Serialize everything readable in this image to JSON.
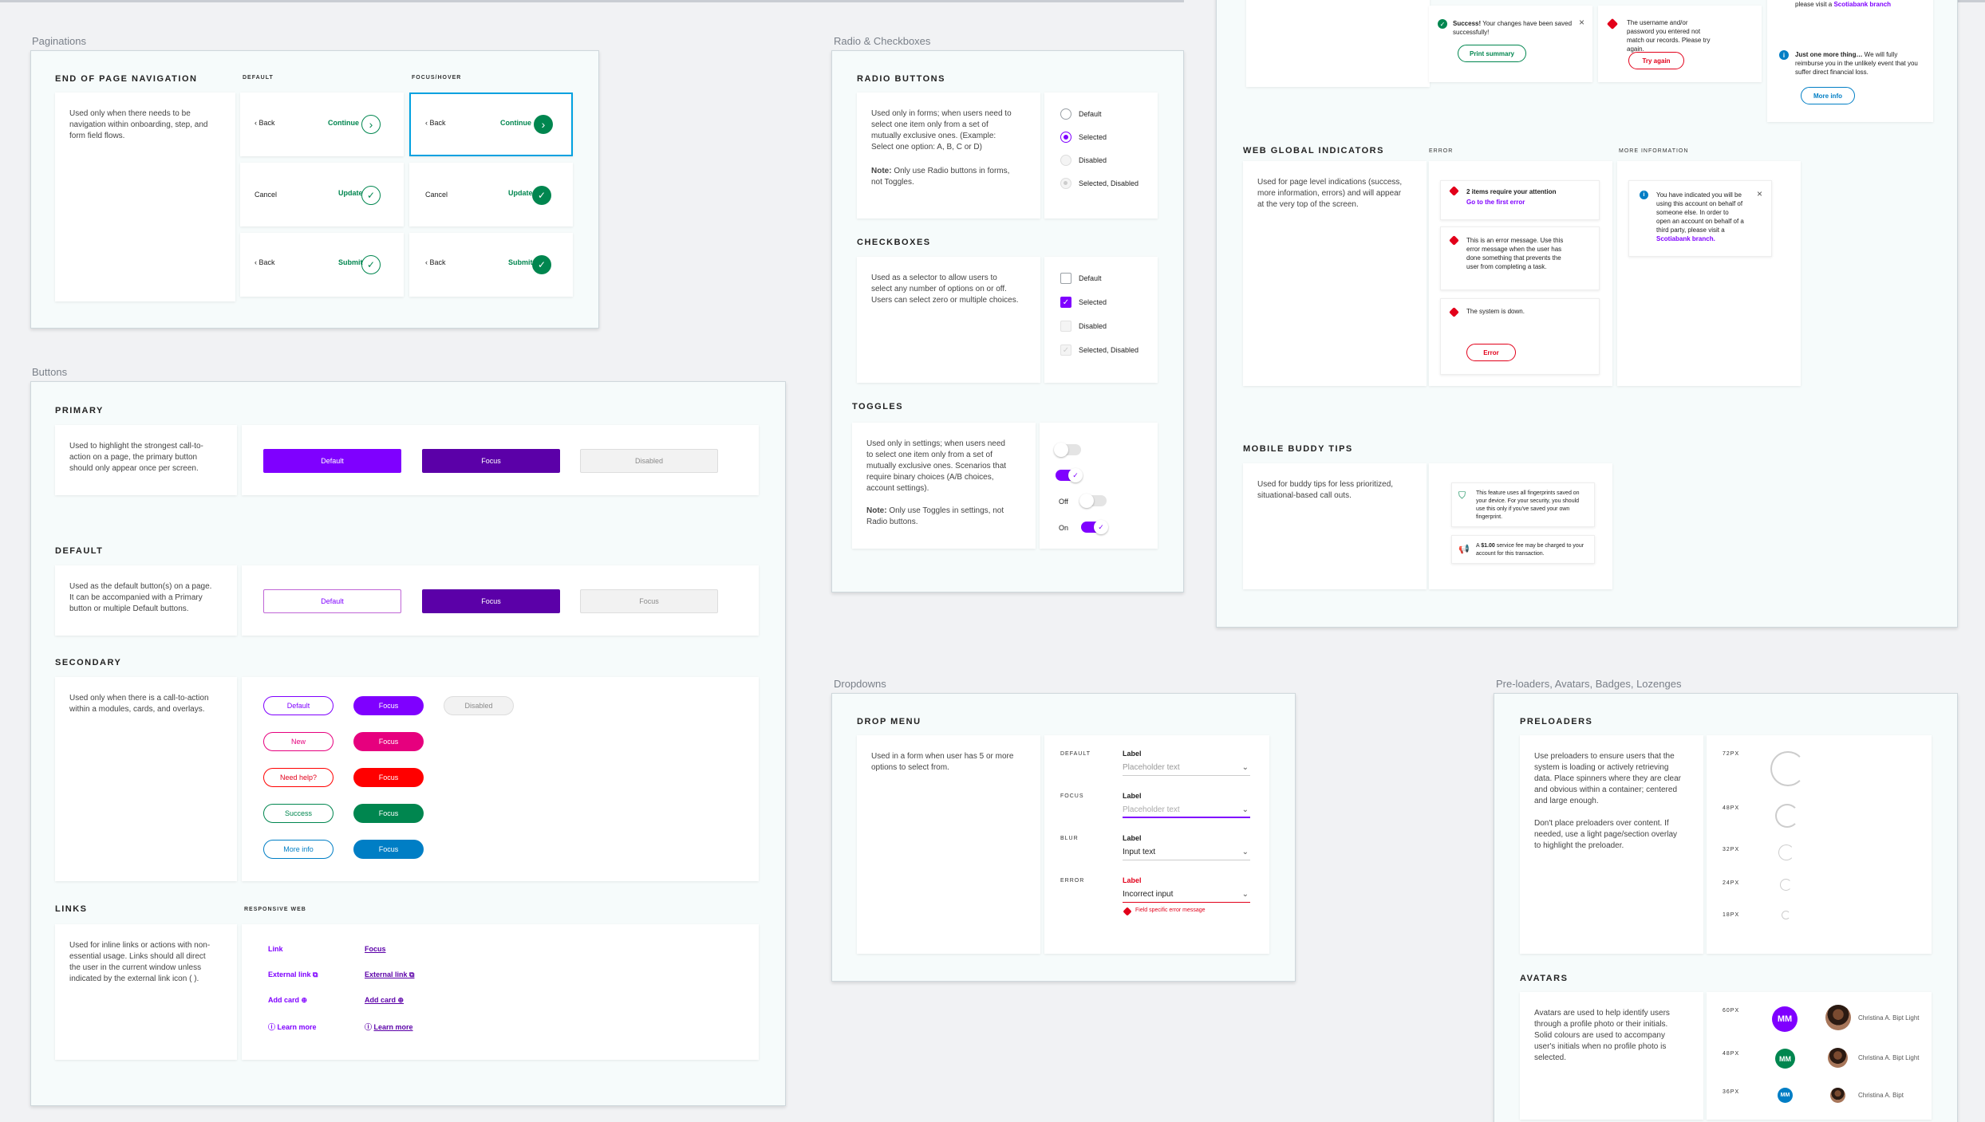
{
  "sections": {
    "paginations": "Paginations",
    "buttons": "Buttons",
    "radio_checkboxes": "Radio & Checkboxes",
    "dropdowns": "Dropdowns",
    "preloaders": "Pre-loaders, Avatars, Badges, Lozenges"
  },
  "pagination": {
    "heading": "END OF PAGE NAVIGATION",
    "col_default": "DEFAULT",
    "col_focus": "FOCUS/HOVER",
    "desc": "Used only when there needs to be navigation within onboarding, step, and form field flows.",
    "back": "Back",
    "continue": "Continue",
    "cancel": "Cancel",
    "update": "Update",
    "submit": "Submit"
  },
  "buttons": {
    "primary": {
      "heading": "PRIMARY",
      "desc": "Used to highlight the strongest call-to-action on a page, the primary button should only appear once per screen.",
      "default": "Default",
      "focus": "Focus",
      "disabled": "Disabled"
    },
    "default": {
      "heading": "DEFAULT",
      "desc": "Used as the default button(s) on a page. It can be accompanied with a Primary button or multiple Default buttons.",
      "default": "Default",
      "focus": "Focus",
      "third": "Focus"
    },
    "secondary": {
      "heading": "SECONDARY",
      "desc": "Used only when there is a call-to-action within a modules, cards, and overlays.",
      "rows": [
        {
          "label": "Default",
          "focus": "Focus",
          "extra": "Disabled",
          "color": "#7f00ff"
        },
        {
          "label": "New",
          "focus": "Focus",
          "color": "#e6007e"
        },
        {
          "label": "Need help?",
          "focus": "Focus",
          "color": "#ff0000"
        },
        {
          "label": "Success",
          "focus": "Focus",
          "color": "#00864f"
        },
        {
          "label": "More info",
          "focus": "Focus",
          "color": "#007ec5"
        }
      ]
    },
    "links": {
      "heading": "LINKS",
      "sub": "RESPONSIVE WEB",
      "desc": "Used for inline links or actions with non-essential usage. Links should all direct the user in the current window unless indicated by the external link icon ( ).",
      "link": "Link",
      "focus": "Focus",
      "external": "External link",
      "add_card": "Add card",
      "learn_more": "Learn more"
    }
  },
  "radio": {
    "heading": "RADIO BUTTONS",
    "desc": "Used only in forms; when users need to select one item only from a set of mutually exclusive ones. (Example: Select one option: A, B, C or D)",
    "note_bold": "Note:",
    "note": " Only use Radio buttons in forms, not Toggles.",
    "options": [
      "Default",
      "Selected",
      "Disabled",
      "Selected, Disabled"
    ]
  },
  "checkboxes": {
    "heading": "CHECKBOXES",
    "desc": "Used as a selector to allow users to select any number of options on or off. Users can select zero or multiple choices.",
    "options": [
      "Default",
      "Selected",
      "Disabled",
      "Selected, Disabled"
    ]
  },
  "toggles": {
    "heading": "TOGGLES",
    "desc": "Used only in settings; when users need to select one item only from a set of mutually exclusive ones. Scenarios that require binary choices (A/B choices, account settings).",
    "note_bold": "Note:",
    "note": " Only use Toggles in settings, not Radio buttons.",
    "off": "Off",
    "on": "On"
  },
  "dropdown": {
    "heading": "DROP MENU",
    "desc": "Used in a form when user has 5 or more options to select from.",
    "states": [
      {
        "state": "DEFAULT",
        "label": "Label",
        "value": "Placeholder text"
      },
      {
        "state": "FOCUS",
        "label": "Label",
        "value": "Placeholder text"
      },
      {
        "state": "BLUR",
        "label": "Label",
        "value": "Input text"
      },
      {
        "state": "ERROR",
        "label": "Label",
        "value": "Incorrect input",
        "error": "Field specific error message"
      }
    ]
  },
  "alerts": {
    "top_right_link": "please visit a ",
    "scotiabank_branch": "Scotiabank branch",
    "success_bold": "Success!",
    "success": " Your changes have been saved successfully!",
    "print_summary": "Print summary",
    "error_msg": "The username and/or password you entered not match our records. Please try again.",
    "try_again": "Try again",
    "info_bold": "Just one more thing…",
    "info": " We will fully reimburse you in the unlikely event that you suffer direct financial loss.",
    "more_info": "More info"
  },
  "global": {
    "heading": "WEB GLOBAL INDICATORS",
    "col_error": "ERROR",
    "col_more": "MORE INFORMATION",
    "desc": "Used for page level indications (success, more information, errors) and will appear at the very top of the screen.",
    "e1_title": "2 items require your attention",
    "e1_link": "Go to the first error",
    "e2": "This is an error message. Use this error message when the user has done something that prevents the user from completing a task.",
    "e3": "The system is down.",
    "e3_btn": "Error",
    "info": "You have indicated you will be using this account on behalf of someone else. In order to open an account on behalf of a third party, please visit a ",
    "info_link": "Scotiabank branch."
  },
  "buddy": {
    "heading": "MOBILE BUDDY TIPS",
    "desc": "Used for buddy tips for less prioritized, situational-based call outs.",
    "tip1": "This feature uses all fingerprints saved on your device. For your security, you should use this only if you've saved your own fingerprint.",
    "tip2_pre": "A ",
    "tip2_bold": "$1.00",
    "tip2": " service fee may be charged to your account for this transaction."
  },
  "preloaders": {
    "heading": "PRELOADERS",
    "desc": "Use preloaders to ensure users that the system is loading or actively retrieving data. Place spinners where they are clear and obvious within a container; centered and large enough.",
    "desc2": "Don't place preloaders over content. If needed, use a light page/section overlay to highlight the preloader.",
    "sizes": [
      "72PX",
      "48PX",
      "32PX",
      "24PX",
      "18PX"
    ]
  },
  "avatars": {
    "heading": "AVATARS",
    "desc": "Avatars are used to help identify users through a profile photo or their initials. Solid colours are used to accompany user's initials when no profile photo is selected.",
    "sizes": [
      "60PX",
      "48PX",
      "36PX"
    ],
    "initials": "MM",
    "names": [
      "Christina A. Bipt Light",
      "Christina A. Bipt Light",
      "Christina A. Bipt"
    ]
  },
  "colors": {
    "purple": "#7f00ff",
    "dark_purple": "#5b00a8",
    "green": "#00864f",
    "blue": "#007ec5",
    "red": "#e2001a",
    "focus_border": "#00a1e0"
  }
}
